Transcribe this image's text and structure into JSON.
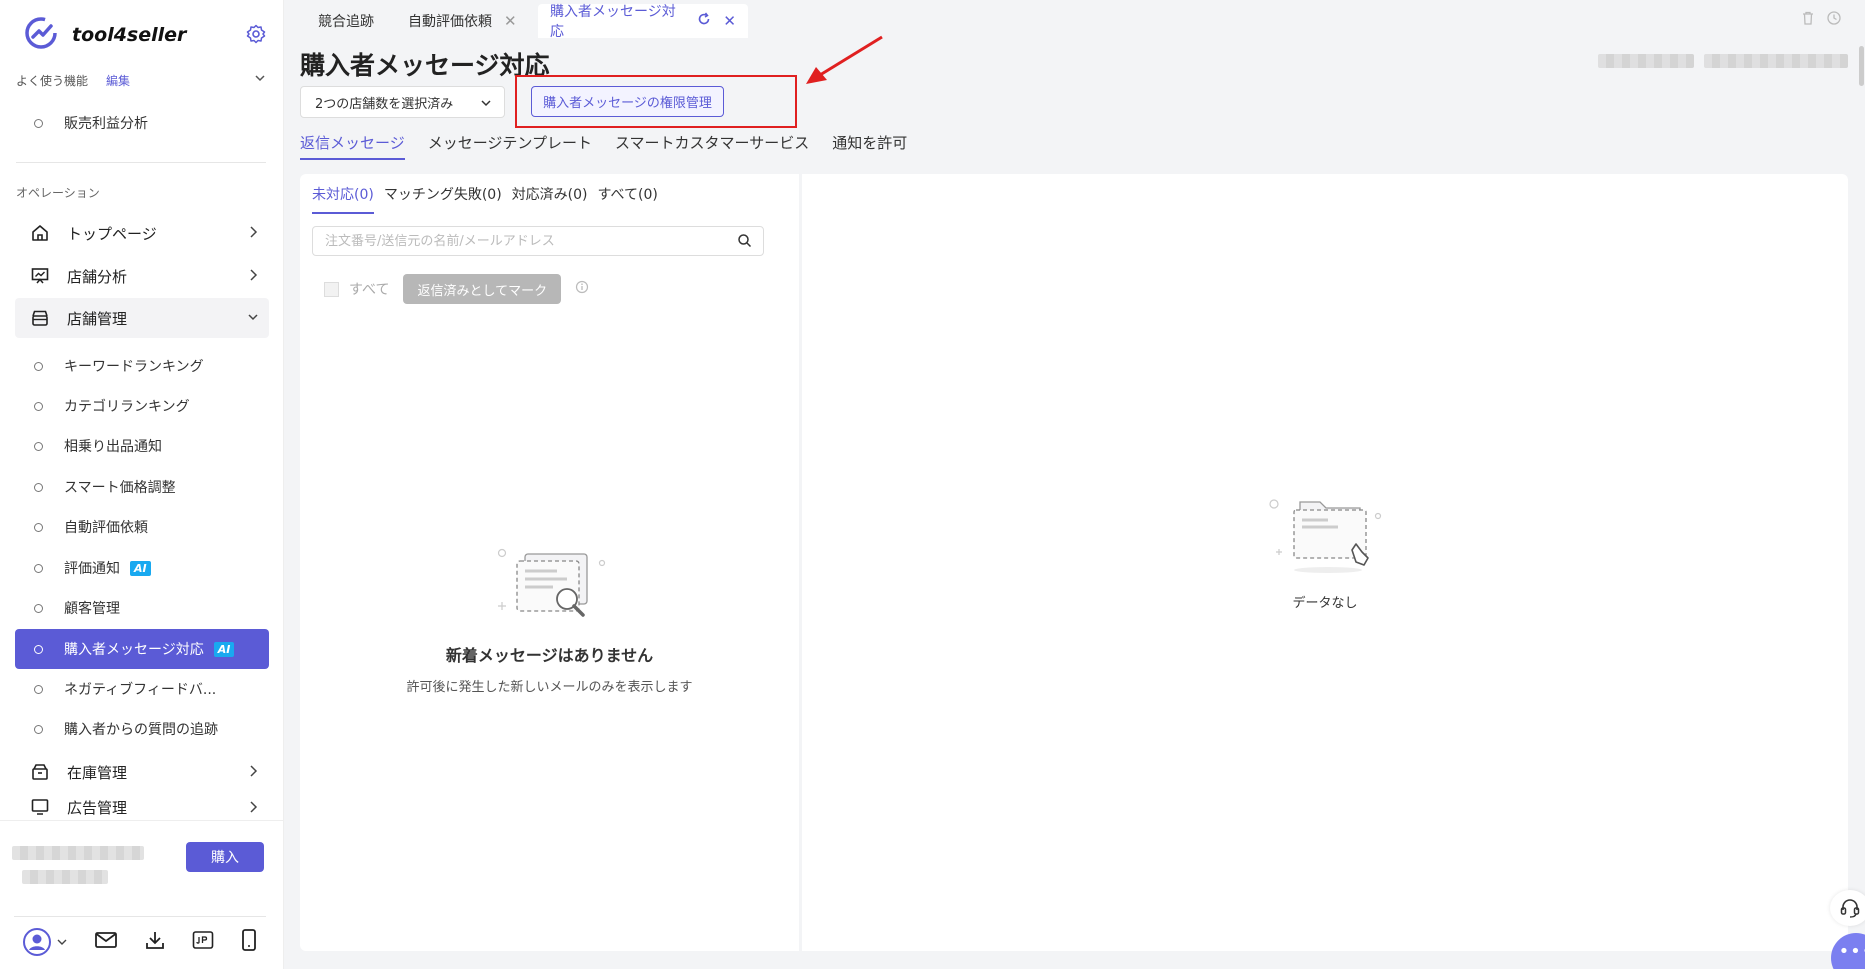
{
  "brand": {
    "name": "tool4seller"
  },
  "favorites": {
    "label": "よく使う機能",
    "edit": "編集",
    "items": [
      "販売利益分析"
    ]
  },
  "section": {
    "title": "オペレーション"
  },
  "menu": {
    "top": "トップページ",
    "store_analysis": "店舗分析",
    "store_manage": "店舗管理",
    "inventory": "在庫管理",
    "ads": "広告管理"
  },
  "store_sub": [
    "キーワードランキング",
    "カテゴリランキング",
    "相乗り出品通知",
    "スマート価格調整",
    "自動評価依頼",
    "評価通知",
    "顧客管理",
    "購入者メッセージ対応",
    "ネガティブフィードバ...",
    "購入者からの質問の追跡"
  ],
  "ai_badge": "AI",
  "buy_label": "購入",
  "tabs": [
    {
      "label": "競合追跡"
    },
    {
      "label": "自動評価依頼"
    },
    {
      "label": "購入者メッセージ対応"
    }
  ],
  "page": {
    "title": "購入者メッセージ対応",
    "store_select": "2つの店舗数を選択済み",
    "permission_button": "購入者メッセージの権限管理"
  },
  "subtabs": [
    "返信メッセージ",
    "メッセージテンプレート",
    "スマートカスタマーサービス",
    "通知を許可"
  ],
  "filter_tabs": [
    "未対応(0)",
    "マッチング失敗(0)",
    "対応済み(0)",
    "すべて(0)"
  ],
  "search": {
    "placeholder": "注文番号/送信元の名前/メールアドレス"
  },
  "bulk": {
    "all_label": "すべて",
    "mark_button": "返信済みとしてマーク"
  },
  "empty_left": {
    "title": "新着メッセージはありません",
    "subtitle": "許可後に発生した新しいメールのみを表示します"
  },
  "empty_right": {
    "text": "データなし"
  },
  "colors": {
    "accent": "#5b5bd6",
    "annotation": "#e02020",
    "ai_badge": "#19a9f0"
  }
}
